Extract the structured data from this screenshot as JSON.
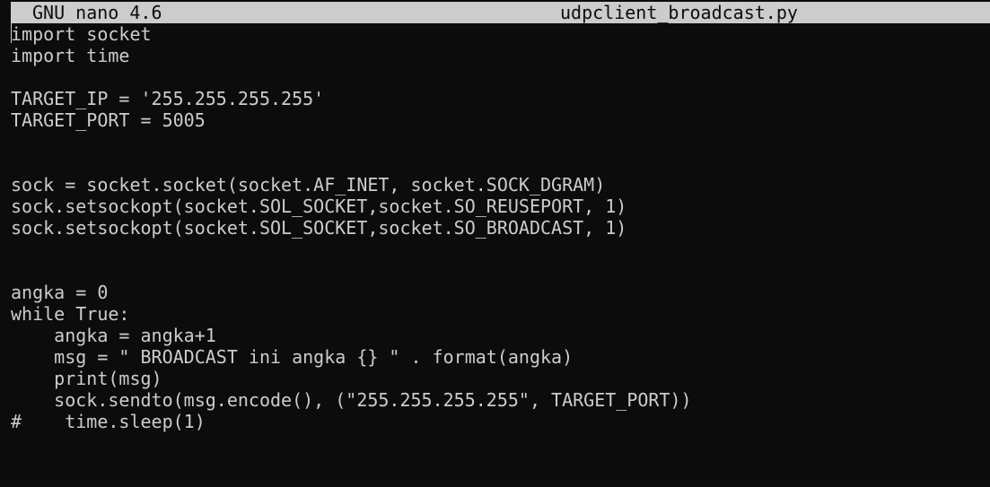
{
  "title_bar": {
    "app_version": "GNU nano 4.6",
    "file_name": "udpclient_broadcast.py"
  },
  "colors": {
    "background": "#0c0c0c",
    "foreground": "#cccccc",
    "title_bar_background": "#cccccc",
    "title_bar_foreground": "#0c0c0c"
  },
  "editor": {
    "lines": [
      "import socket",
      "import time",
      "",
      "TARGET_IP = '255.255.255.255'",
      "TARGET_PORT = 5005",
      "",
      "",
      "sock = socket.socket(socket.AF_INET, socket.SOCK_DGRAM)",
      "sock.setsockopt(socket.SOL_SOCKET,socket.SO_REUSEPORT, 1)",
      "sock.setsockopt(socket.SOL_SOCKET,socket.SO_BROADCAST, 1)",
      "",
      "",
      "angka = 0",
      "while True:",
      "    angka = angka+1",
      "    msg = \" BROADCAST ini angka {} \" . format(angka)",
      "    print(msg)",
      "    sock.sendto(msg.encode(), (\"255.255.255.255\", TARGET_PORT))",
      "#    time.sleep(1)"
    ]
  }
}
